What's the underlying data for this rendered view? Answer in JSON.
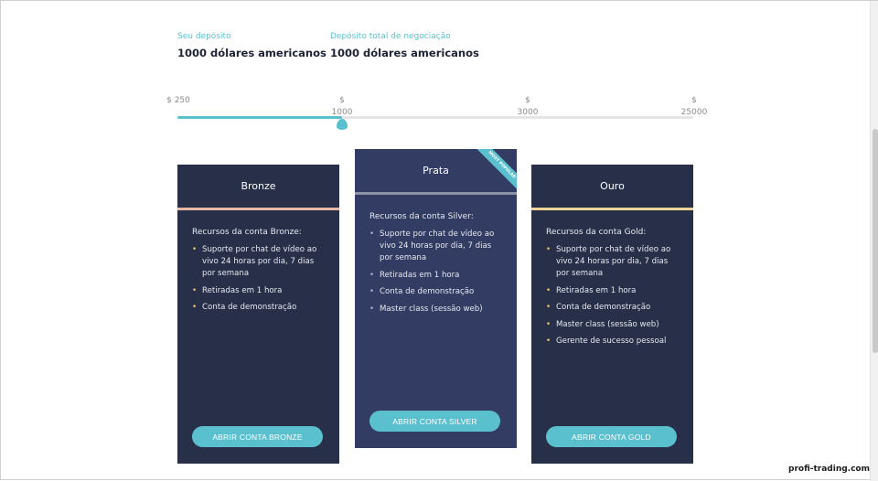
{
  "deposit": {
    "label": "Seu depósito",
    "value": "1000 dólares americanos"
  },
  "total": {
    "label": "Depósito total de negociação",
    "value": "1000 dólares americanos"
  },
  "slider": {
    "ticks": [
      {
        "line1": "$ 250",
        "line2": ""
      },
      {
        "line1": "$",
        "line2": "1000"
      },
      {
        "line1": "$",
        "line2": "3000"
      },
      {
        "line1": "$",
        "line2": "25000"
      }
    ],
    "selected": "1000",
    "accent": "#5bc0ce"
  },
  "plans": [
    {
      "name": "Bronze",
      "divider_color": "#e8b9a6",
      "resources_title": "Recursos da conta Bronze:",
      "features": [
        "Suporte por chat de vídeo ao vivo 24 horas por dia, 7 dias por semana",
        "Retiradas em 1 hora",
        "Conta de demonstração"
      ],
      "button": "ABRIR CONTA BRONZE"
    },
    {
      "name": "Prata",
      "divider_color": "#8f93a3",
      "badge": "MOST POPULAR",
      "resources_title": "Recursos da conta Silver:",
      "features": [
        "Suporte por chat de vídeo ao vivo 24 horas por dia, 7 dias por semana",
        "Retiradas em 1 hora",
        "Conta de demonstração",
        "Master class (sessão web)"
      ],
      "button": "ABRIR CONTA SILVER"
    },
    {
      "name": "Ouro",
      "divider_color": "#f3d59b",
      "resources_title": "Recursos da conta Gold:",
      "features": [
        "Suporte por chat de vídeo ao vivo 24 horas por dia, 7 dias por semana",
        "Retiradas em 1 hora",
        "Conta de demonstração",
        "Master class (sessão web)",
        "Gerente de sucesso pessoal"
      ],
      "button": "ABRIR CONTA GOLD"
    }
  ],
  "watermark": "profi-trading.com"
}
